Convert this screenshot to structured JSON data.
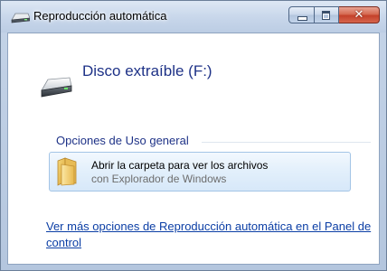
{
  "window": {
    "title": "Reproducción automática",
    "title_icon": "drive-icon",
    "controls": {
      "minimize": "minimize",
      "maximize": "maximize",
      "close": "close"
    }
  },
  "device": {
    "title": "Disco extraíble (F:)",
    "icon": "removable-drive-icon"
  },
  "general_options": {
    "label": "Opciones de Uso general",
    "items": [
      {
        "title": "Abrir la carpeta para ver los archivos",
        "subtitle": "con Explorador de Windows",
        "icon": "folder-icon"
      }
    ]
  },
  "more_options_link": "Ver más opciones de Reproducción automática en el Panel de control",
  "colors": {
    "heading": "#1e3287",
    "link": "#0b3ea5",
    "close_button": "#c4412a",
    "action_background": "#e2effb"
  }
}
